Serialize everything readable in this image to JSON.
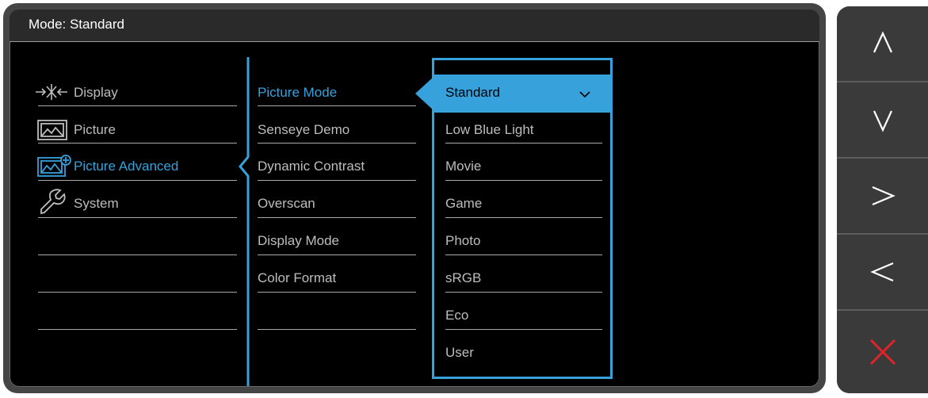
{
  "title": "Mode: Standard",
  "menu": [
    {
      "label": "Display",
      "icon": "display-icon",
      "active": false
    },
    {
      "label": "Picture",
      "icon": "picture-icon",
      "active": false
    },
    {
      "label": "Picture Advanced",
      "icon": "picture-advanced-icon",
      "active": true
    },
    {
      "label": "System",
      "icon": "wrench-icon",
      "active": false
    }
  ],
  "submenu": [
    {
      "label": "Picture Mode",
      "active": true
    },
    {
      "label": "Senseye Demo",
      "active": false
    },
    {
      "label": "Dynamic Contrast",
      "active": false
    },
    {
      "label": "Overscan",
      "active": false
    },
    {
      "label": "Display Mode",
      "active": false
    },
    {
      "label": "Color Format",
      "active": false
    }
  ],
  "options": [
    {
      "label": "Standard",
      "selected": true
    },
    {
      "label": "Low Blue Light",
      "selected": false
    },
    {
      "label": "Movie",
      "selected": false
    },
    {
      "label": "Game",
      "selected": false
    },
    {
      "label": "Photo",
      "selected": false
    },
    {
      "label": "sRGB",
      "selected": false
    },
    {
      "label": "Eco",
      "selected": false
    },
    {
      "label": "User",
      "selected": false
    }
  ],
  "buttons": [
    {
      "name": "up-button",
      "icon": "chevron-up-icon"
    },
    {
      "name": "down-button",
      "icon": "chevron-down-icon"
    },
    {
      "name": "right-button",
      "icon": "chevron-right-icon"
    },
    {
      "name": "left-button",
      "icon": "chevron-left-icon"
    },
    {
      "name": "exit-button",
      "icon": "close-icon"
    }
  ],
  "colors": {
    "accent": "#36a1db",
    "exit": "#e0242b"
  }
}
